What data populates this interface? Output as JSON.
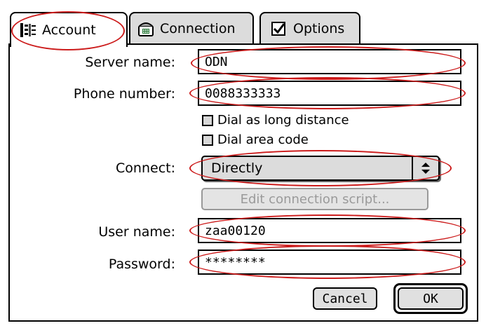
{
  "tabs": [
    {
      "label": "Account",
      "icon": "account-icon",
      "active": true
    },
    {
      "label": "Connection",
      "icon": "connection-icon",
      "active": false
    },
    {
      "label": "Options",
      "icon": "checkbox-icon",
      "active": false
    }
  ],
  "form": {
    "server_label": "Server name:",
    "server_value": "ODN",
    "phone_label": "Phone number:",
    "phone_value": "0088333333",
    "dial_long_distance_label": "Dial as long distance",
    "dial_area_code_label": "Dial area code",
    "connect_label": "Connect:",
    "connect_value": "Directly",
    "edit_script_label": "Edit connection script...",
    "username_label": "User name:",
    "username_value": "zaa00120",
    "password_label": "Password:",
    "password_value": "********"
  },
  "buttons": {
    "cancel": "Cancel",
    "ok": "OK"
  },
  "annotation_color": "#cc1b1b"
}
